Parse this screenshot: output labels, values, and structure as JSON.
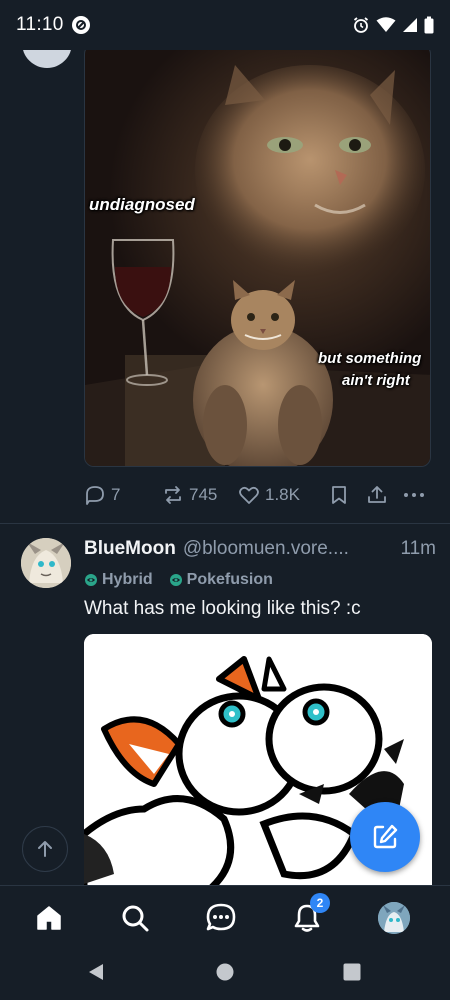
{
  "status_bar": {
    "time": "11:10",
    "icons": [
      "app-notification-icon",
      "alarm-icon",
      "wifi-icon",
      "cellular-signal-icon",
      "battery-icon"
    ]
  },
  "previous_post": {
    "image": {
      "caption_top": "undiagnosed",
      "caption_bottom_line1": "but something",
      "caption_bottom_line2": "ain't right"
    },
    "actions": {
      "replies": "7",
      "reposts": "745",
      "likes": "1.8K"
    }
  },
  "post": {
    "display_name": "BlueMoon",
    "handle": "@bloomuen.vore....",
    "time": "11m",
    "tags": [
      "Hybrid",
      "Pokefusion"
    ],
    "text": "What has me looking like this? :c"
  },
  "bottom_nav": {
    "items": [
      "home",
      "search",
      "chat",
      "notifications",
      "profile"
    ],
    "notification_count": "2"
  },
  "colors": {
    "background": "#161e27",
    "accent": "#2f86f6",
    "muted_text": "#8f9cac",
    "divider": "#2a3542"
  }
}
